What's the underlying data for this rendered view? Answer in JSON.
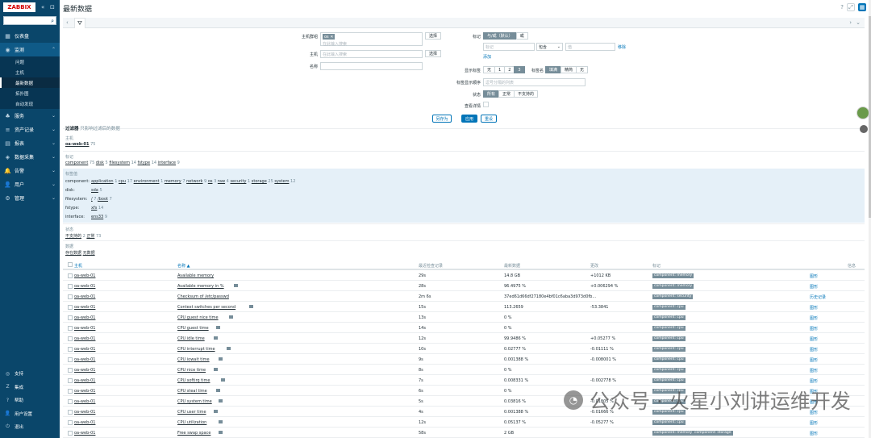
{
  "app": {
    "logo": "ZABBIX",
    "collapse": "«",
    "expand": "⊡"
  },
  "sidebar": {
    "nav": [
      {
        "label": "仪表盘",
        "icon": "dashboard-icon",
        "glyph": "▦"
      },
      {
        "label": "监测",
        "icon": "monitoring-icon",
        "glyph": "◉",
        "expanded": true
      }
    ],
    "sub": [
      "问题",
      "主机",
      "最新数据",
      "拓扑图",
      "自动发现"
    ],
    "selected_sub": "最新数据",
    "nav2": [
      {
        "label": "服务",
        "icon": "services-icon",
        "glyph": "♣"
      },
      {
        "label": "资产记录",
        "icon": "inventory-icon",
        "glyph": "≡"
      },
      {
        "label": "报表",
        "icon": "reports-icon",
        "glyph": "▤"
      },
      {
        "label": "数据采集",
        "icon": "data-collection-icon",
        "glyph": "◈"
      },
      {
        "label": "告警",
        "icon": "alerts-icon",
        "glyph": "🔔"
      },
      {
        "label": "用户",
        "icon": "users-icon",
        "glyph": "👤"
      },
      {
        "label": "管理",
        "icon": "administration-icon",
        "glyph": "⚙"
      }
    ],
    "bottom": [
      {
        "label": "支持",
        "glyph": "◎"
      },
      {
        "label": "集成",
        "glyph": "Z"
      },
      {
        "label": "帮助",
        "glyph": "?"
      },
      {
        "label": "用户设置",
        "glyph": "👤"
      },
      {
        "label": "退出",
        "glyph": "⏻"
      }
    ]
  },
  "header": {
    "title": "最新数据",
    "help": "?"
  },
  "filter": {
    "host_group_label": "主机群组",
    "host_group_chip": "os ✕",
    "host_group_placeholder": "在此输入搜索",
    "select": "选择",
    "host_label": "主机",
    "host_placeholder": "在此输入搜索",
    "name_label": "名称",
    "tags_label": "标记",
    "tags_and_or": "与/或（默认）",
    "tags_or": "或",
    "tag_placeholder": "标记",
    "tag_op": "包含",
    "tag_value_placeholder": "值",
    "remove": "移除",
    "add": "添加",
    "show_tags_label": "显示标签",
    "show_tags_opts": [
      "无",
      "1",
      "2",
      "3"
    ],
    "tag_name_label": "标签名",
    "tag_name_opts": [
      "填满",
      "精简",
      "无"
    ],
    "tag_priority_label": "标签显示顺序",
    "tag_priority_placeholder": "逗号分隔的列表",
    "state_label": "状态",
    "state_opts": [
      "所有",
      "正常",
      "不支持的"
    ],
    "details_label": "查看详情",
    "save_as": "另存为",
    "apply": "应用",
    "reset": "重设"
  },
  "subfilter": {
    "title": "过滤器",
    "hint": "只影响过滤后的数据",
    "hosts_cap": "主机",
    "host": "oa-web-01",
    "host_count": "75",
    "tags_cap": "标记",
    "tags": [
      {
        "name": "component",
        "count": "75"
      },
      {
        "name": "disk",
        "count": "5"
      },
      {
        "name": "filesystem",
        "count": "14"
      },
      {
        "name": "fstype",
        "count": "14"
      },
      {
        "name": "interface",
        "count": "9"
      }
    ],
    "tag_values_cap": "标签值",
    "tag_value_rows": [
      {
        "label": "component:",
        "items": [
          [
            "application",
            "1"
          ],
          [
            "cpu",
            "17"
          ],
          [
            "environment",
            "1"
          ],
          [
            "memory",
            "7"
          ],
          [
            "network",
            "9"
          ],
          [
            "os",
            "3"
          ],
          [
            "raw",
            "4"
          ],
          [
            "security",
            "1"
          ],
          [
            "storage",
            "25"
          ],
          [
            "system",
            "12"
          ]
        ]
      },
      {
        "label": "disk:",
        "items": [
          [
            "sda",
            "5"
          ]
        ]
      },
      {
        "label": "filesystem:",
        "items": [
          [
            "/",
            "7"
          ],
          [
            "/boot",
            "7"
          ]
        ]
      },
      {
        "label": "fstype:",
        "items": [
          [
            "xfs",
            "14"
          ]
        ]
      },
      {
        "label": "interface:",
        "items": [
          [
            "ens33",
            "9"
          ]
        ]
      }
    ],
    "state_cap": "状态",
    "states": [
      {
        "name": "不支持的",
        "count": "2"
      },
      {
        "name": "正常",
        "count": "73"
      }
    ],
    "data_cap": "数据",
    "data": [
      "存在数据",
      "无数据"
    ]
  },
  "table": {
    "headers": [
      "主机",
      "名称 ▲",
      "最近检查记录",
      "最新数据",
      "更改",
      "标记",
      "信息"
    ],
    "rows": [
      {
        "host": "oa-web-01",
        "name": "Available memory",
        "info": false,
        "last": "29s",
        "value": "14.8 GB",
        "change": "+1012 KB",
        "tags": [
          "component: memory"
        ],
        "link": "图形"
      },
      {
        "host": "oa-web-01",
        "name": "Available memory in %",
        "info": true,
        "last": "28s",
        "value": "96.4975 %",
        "change": "+0.006294 %",
        "tags": [
          "component: memory"
        ],
        "link": "图形"
      },
      {
        "host": "oa-web-01",
        "name": "Checksum of /etc/passwd",
        "info": false,
        "last": "2m 6s",
        "value": "37ed61d66df27180e4bf01c6aba3d973d0fb...",
        "change": "",
        "tags": [
          "component: security"
        ],
        "link": "历史记录"
      },
      {
        "host": "oa-web-01",
        "name": "Context switches per second",
        "info": true,
        "last": "15s",
        "value": "113.2659",
        "change": "-53.3841",
        "tags": [
          "component: cpu"
        ],
        "link": "图形"
      },
      {
        "host": "oa-web-01",
        "name": "CPU guest nice time",
        "info": true,
        "last": "13s",
        "value": "0 %",
        "change": "",
        "tags": [
          "component: cpu"
        ],
        "link": "图形"
      },
      {
        "host": "oa-web-01",
        "name": "CPU guest time",
        "info": true,
        "last": "14s",
        "value": "0 %",
        "change": "",
        "tags": [
          "component: cpu"
        ],
        "link": "图形"
      },
      {
        "host": "oa-web-01",
        "name": "CPU idle time",
        "info": true,
        "last": "12s",
        "value": "99.9486 %",
        "change": "+0.05277 %",
        "tags": [
          "component: cpu"
        ],
        "link": "图形"
      },
      {
        "host": "oa-web-01",
        "name": "CPU interrupt time",
        "info": true,
        "last": "10s",
        "value": "0.02777 %",
        "change": "-0.01111 %",
        "tags": [
          "component: cpu"
        ],
        "link": "图形"
      },
      {
        "host": "oa-web-01",
        "name": "CPU iowait time",
        "info": true,
        "last": "9s",
        "value": "0.001388 %",
        "change": "-0.008001 %",
        "tags": [
          "component: cpu"
        ],
        "link": "图形"
      },
      {
        "host": "oa-web-01",
        "name": "CPU nice time",
        "info": true,
        "last": "8s",
        "value": "0 %",
        "change": "",
        "tags": [
          "component: cpu"
        ],
        "link": "图形"
      },
      {
        "host": "oa-web-01",
        "name": "CPU softirq time",
        "info": true,
        "last": "7s",
        "value": "0.008331 %",
        "change": "-0.002778 %",
        "tags": [
          "component: cpu"
        ],
        "link": "图形"
      },
      {
        "host": "oa-web-01",
        "name": "CPU steal time",
        "info": true,
        "last": "6s",
        "value": "0 %",
        "change": "",
        "tags": [
          "component: cpu"
        ],
        "link": "图形"
      },
      {
        "host": "oa-web-01",
        "name": "CPU system time",
        "info": true,
        "last": "5s",
        "value": "0.03816 %",
        "change": "-0.01805 %",
        "tags": [
          "component: cpu"
        ],
        "link": "图形"
      },
      {
        "host": "oa-web-01",
        "name": "CPU user time",
        "info": true,
        "last": "4s",
        "value": "0.001388 %",
        "change": "-0.01666 %",
        "tags": [
          "component: cpu"
        ],
        "link": "图形"
      },
      {
        "host": "oa-web-01",
        "name": "CPU utilization",
        "info": true,
        "last": "12s",
        "value": "0.05137 %",
        "change": "-0.05277 %",
        "tags": [
          "component: cpu"
        ],
        "link": "图形"
      },
      {
        "host": "oa-web-01",
        "name": "Free swap space",
        "info": true,
        "last": "58s",
        "value": "2 GB",
        "change": "",
        "tags": [
          "component: memory",
          "component: storage"
        ],
        "link": "图形"
      }
    ]
  },
  "watermark": "公众号 · 火星小刘讲运维开发"
}
